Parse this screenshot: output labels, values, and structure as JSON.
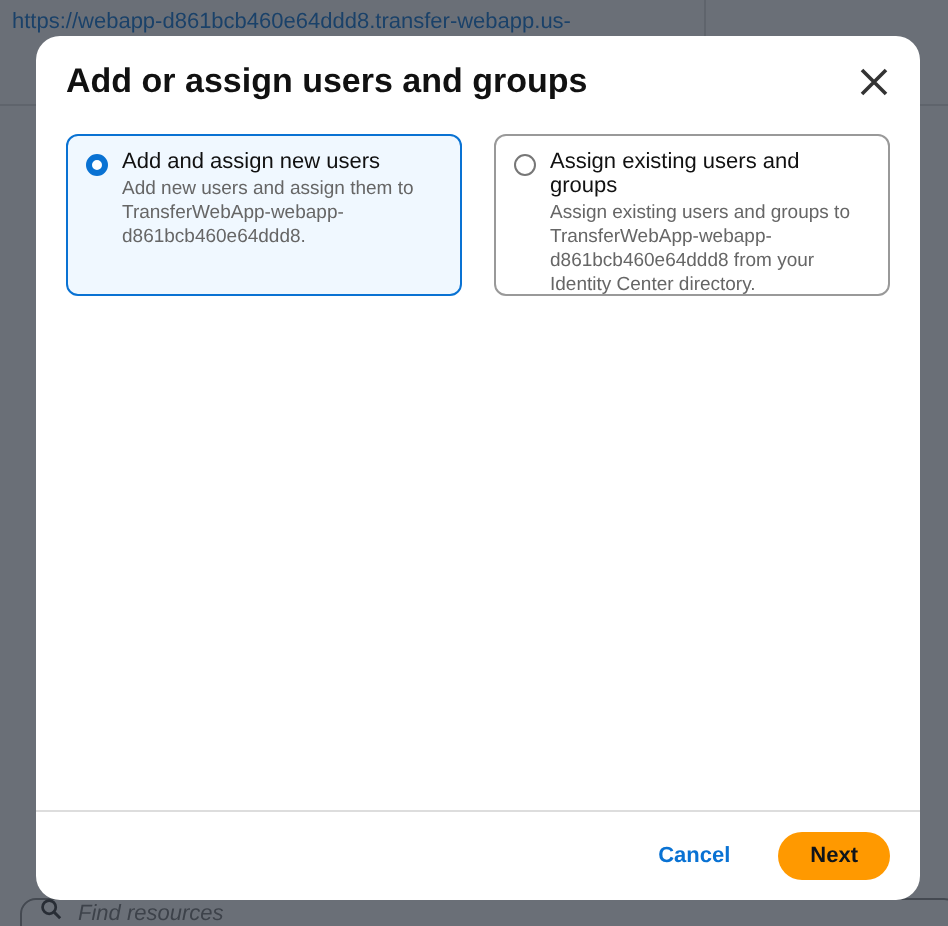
{
  "page": {
    "endpoint_link": "https://webapp-d861bcb460e64ddd8.transfer-webapp.us-",
    "search": {
      "placeholder": "Find resources"
    }
  },
  "dialog": {
    "title": "Add or assign users and groups",
    "options": [
      {
        "label": "Add and assign new users",
        "description": "Add new users and assign them to TransferWebApp-webapp-d861bcb460e64ddd8.",
        "selected": true
      },
      {
        "label": "Assign existing users and groups",
        "description": "Assign existing users and groups to TransferWebApp-webapp-d861bcb460e64ddd8 from your Identity Center directory.",
        "selected": false
      }
    ],
    "buttons": [
      {
        "label": "Cancel",
        "kind": "link"
      },
      {
        "label": "Next",
        "kind": "primary"
      }
    ]
  }
}
